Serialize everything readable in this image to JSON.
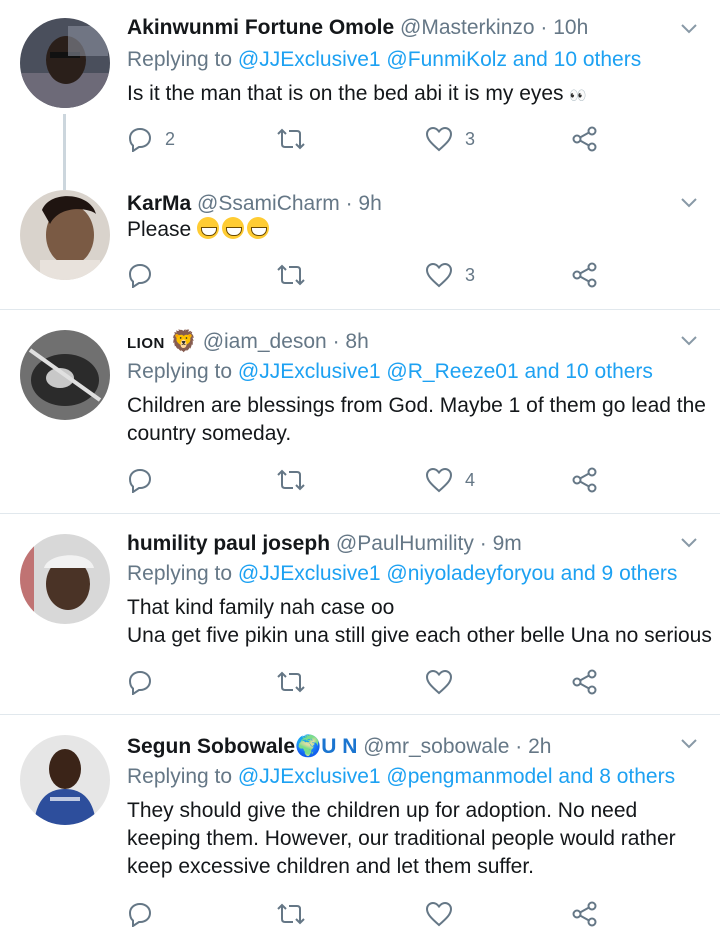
{
  "tweets": [
    {
      "name": "Akinwunmi Fortune Omole",
      "handle": "@Masterkinzo",
      "dot": " · ",
      "time": "10h",
      "reply_prefix": "Replying to ",
      "reply_links": "@JJExclusive1 @FunmiKolz and 10 others",
      "body": "Is it the man that is on the bed abi it is my eyes",
      "body_suffix": "👀",
      "reply_count": "2",
      "like_count": "3",
      "avatar_color": "#3b3f4a"
    },
    {
      "name": "KarMa",
      "handle": "@SsamiCharm",
      "dot": " · ",
      "time": "9h",
      "body": "Please",
      "body_emoji_names": [
        "grinning-squinting-face",
        "grinning-squinting-face",
        "grinning-squinting-face"
      ],
      "like_count": "3",
      "avatar_color": "#8a6e5a"
    },
    {
      "name": "LION",
      "name_emoji": "🦁",
      "handle": "@iam_deson",
      "dot": " · ",
      "time": "8h",
      "reply_prefix": "Replying to ",
      "reply_links": "@JJExclusive1 @R_Reeze01 and 10 others",
      "body": "Children are blessings from God. Maybe 1 of them go lead the country someday.",
      "like_count": "4",
      "avatar_color": "#5a5a5a"
    },
    {
      "name": "humility paul joseph",
      "handle": "@PaulHumility",
      "dot": " · ",
      "time": "9m",
      "reply_prefix": "Replying to ",
      "reply_links": "@JJExclusive1 @niyoladeyforyou and 9 others",
      "body_line1": "That kind family nah case oo",
      "body_line2": "Una get five pikin una still give each other belle Una no serious",
      "avatar_color": "#cfcfcf"
    },
    {
      "name": "Segun Sobowale",
      "name_emoji": "🌍",
      "name_suffix": "U N",
      "handle": "@mr_sobowale",
      "dot": " · ",
      "time": "2h",
      "reply_prefix": "Replying to ",
      "reply_links": "@JJExclusive1 @pengmanmodel and 8 others",
      "body": "They should give the children up for adoption. No need keeping them. However, our traditional people would rather keep excessive children and let them suffer.",
      "avatar_color": "#2d4e9c"
    }
  ],
  "colors": {
    "link": "#1da1f2",
    "muted": "#657786",
    "text": "#14171a",
    "divider": "#e1e8ed"
  },
  "icons": [
    "reply-icon",
    "retweet-icon",
    "like-icon",
    "share-icon",
    "chevron-down-icon"
  ]
}
